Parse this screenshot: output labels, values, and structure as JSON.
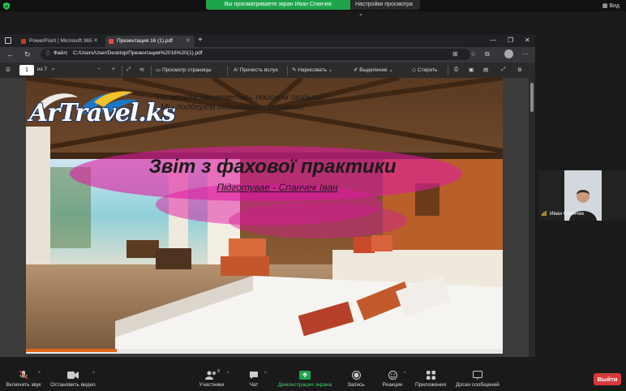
{
  "zoom": {
    "share_banner": "Вы просматриваете экран Иван Спанчек",
    "view_options": "Настройки просмотра",
    "view_button": "Вид",
    "participant_name": "Иван Спанчек",
    "toolbar": {
      "mute": "Включить звук",
      "video": "Остановить видео",
      "participants": "Участники",
      "participants_count": "8",
      "chat": "Чат",
      "share": "Демонстрация экрана",
      "record": "Запись",
      "reactions": "Реакции",
      "apps": "Приложения",
      "whiteboard": "Доски сообщений",
      "leave": "Выйти"
    },
    "colors": {
      "share_green": "#1ea54b",
      "leave_red": "#d63a3a"
    }
  },
  "browser": {
    "tabs": [
      {
        "label": "PowerPoint | Microsoft 365"
      },
      {
        "label": "Презентация 16 (1).pdf"
      }
    ],
    "address": {
      "scheme_label": "Файл",
      "url": "C:/Users/User/Desktop/Презентация%2016%20(1).pdf"
    },
    "pdf_toolbar": {
      "page_current": "1",
      "page_total": "из 7",
      "zoom_minus": "−",
      "zoom_plus": "+",
      "page_view": "Просмотр страницы",
      "read_aloud": "Прочесть вслух",
      "draw": "Нарисовать",
      "highlight": "Выделение",
      "erase": "Стереть"
    }
  },
  "slide": {
    "logo": "ArTravel.ks",
    "tagline_1": "\"Не всегда занимаетесь поиском отдыха?",
    "tagline_2": "Мы подберём подходящее решение\"",
    "title": "Звіт з фахової практики",
    "subtitle": "Підготувае - Спанчек Іван"
  }
}
